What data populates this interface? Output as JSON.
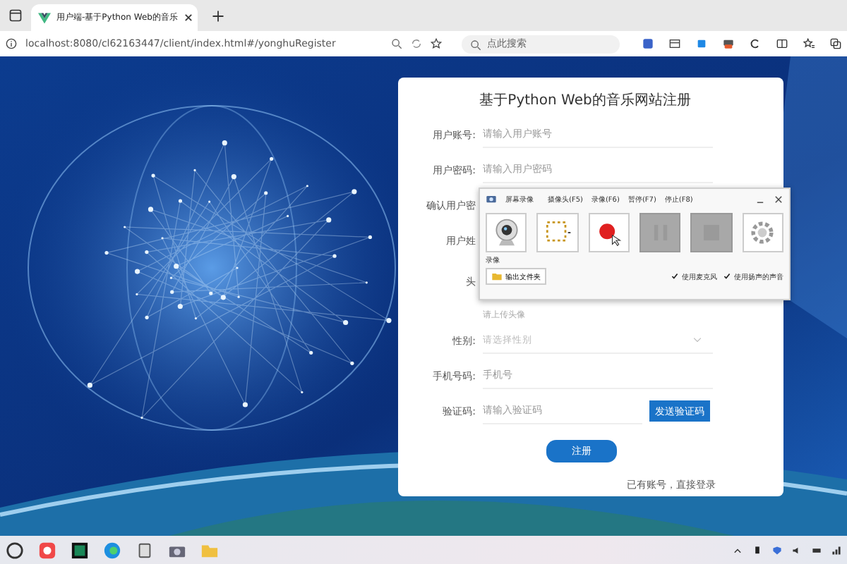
{
  "browser": {
    "tab": {
      "title": "用户端-基于Python Web的音乐"
    },
    "address": "localhost:8080/cl62163447/client/index.html#/yonghuRegister",
    "search": {
      "placeholder": "点此搜索"
    }
  },
  "form": {
    "title": "基于Python Web的音乐网站注册",
    "fields": [
      {
        "kind": "input",
        "label": "用户账号:",
        "placeholder": "请输入用户账号"
      },
      {
        "kind": "input",
        "label": "用户密码:",
        "placeholder": "请输入用户密码"
      },
      {
        "kind": "covered",
        "label": "确认用户密"
      },
      {
        "kind": "covered",
        "label": "用户姓"
      },
      {
        "kind": "avatar",
        "label": "头",
        "hint": "请上传头像"
      },
      {
        "kind": "select",
        "label": "性别:",
        "placeholder": "请选择性别"
      },
      {
        "kind": "input",
        "label": "手机号码:",
        "placeholder": "手机号"
      },
      {
        "kind": "code",
        "label": "验证码:",
        "placeholder": "请输入验证码",
        "button": "发送验证码"
      }
    ],
    "submit": "注册",
    "login_link": "已有账号，直接登录"
  },
  "recorder": {
    "title": "屏幕录像",
    "menu": [
      "摄像头(F5)",
      "录像(F6)",
      "暂停(F7)",
      "停止(F8)"
    ],
    "tools": [
      {
        "kind": "webcam",
        "disabled": false
      },
      {
        "kind": "region",
        "disabled": false
      },
      {
        "kind": "record",
        "disabled": false
      },
      {
        "kind": "pause",
        "disabled": true
      },
      {
        "kind": "stop",
        "disabled": true
      },
      {
        "kind": "settings",
        "disabled": false
      }
    ],
    "tool_caption": "录像",
    "folder_button": "输出文件夹",
    "options": [
      {
        "label": "使用麦克风",
        "checked": true
      },
      {
        "label": "使用扬声的声音",
        "checked": true
      }
    ]
  }
}
